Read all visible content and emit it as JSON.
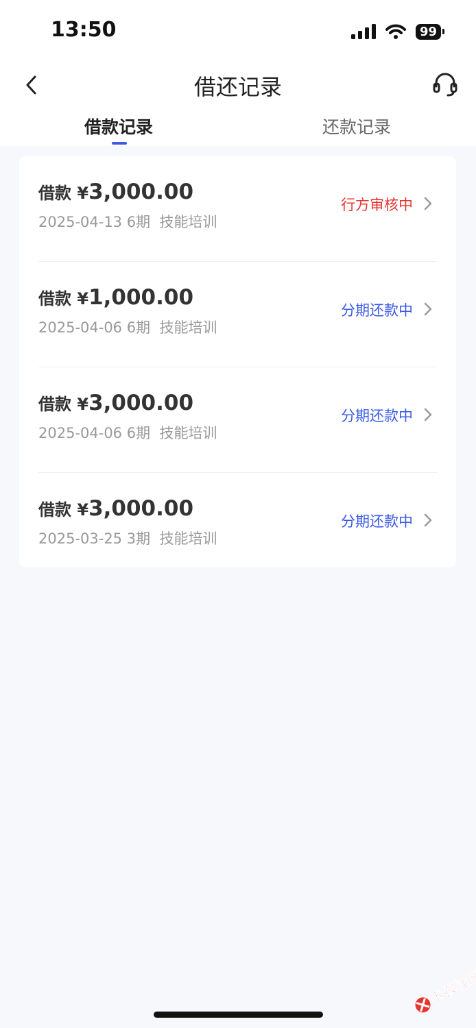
{
  "status_bar": {
    "time": "13:50",
    "battery": "99"
  },
  "header": {
    "title": "借还记录"
  },
  "tabs": [
    {
      "label": "借款记录"
    },
    {
      "label": "还款记录"
    }
  ],
  "records": [
    {
      "prefix": "借款 ¥",
      "amount": "3,000.00",
      "date": "2025-04-13",
      "periods": "6期",
      "purpose": "技能培训",
      "status": "行方审核中",
      "status_color": "#e8332e"
    },
    {
      "prefix": "借款 ¥",
      "amount": "1,000.00",
      "date": "2025-04-06",
      "periods": "6期",
      "purpose": "技能培训",
      "status": "分期还款中",
      "status_color": "#3a5ae8"
    },
    {
      "prefix": "借款 ¥",
      "amount": "3,000.00",
      "date": "2025-04-06",
      "periods": "6期",
      "purpose": "技能培训",
      "status": "分期还款中",
      "status_color": "#3a5ae8"
    },
    {
      "prefix": "借款 ¥",
      "amount": "3,000.00",
      "date": "2025-03-25",
      "periods": "3期",
      "purpose": "技能培训",
      "status": "分期还款中",
      "status_color": "#3a5ae8"
    }
  ],
  "watermark": {
    "text": "卡农社区"
  },
  "icons": {
    "back": "chevron-left-icon",
    "support": "headset-icon",
    "row_arrow": "chevron-right-icon"
  },
  "colors": {
    "accent": "#3a5ae8",
    "warning": "#e8332e",
    "background": "#f7f8fc"
  }
}
